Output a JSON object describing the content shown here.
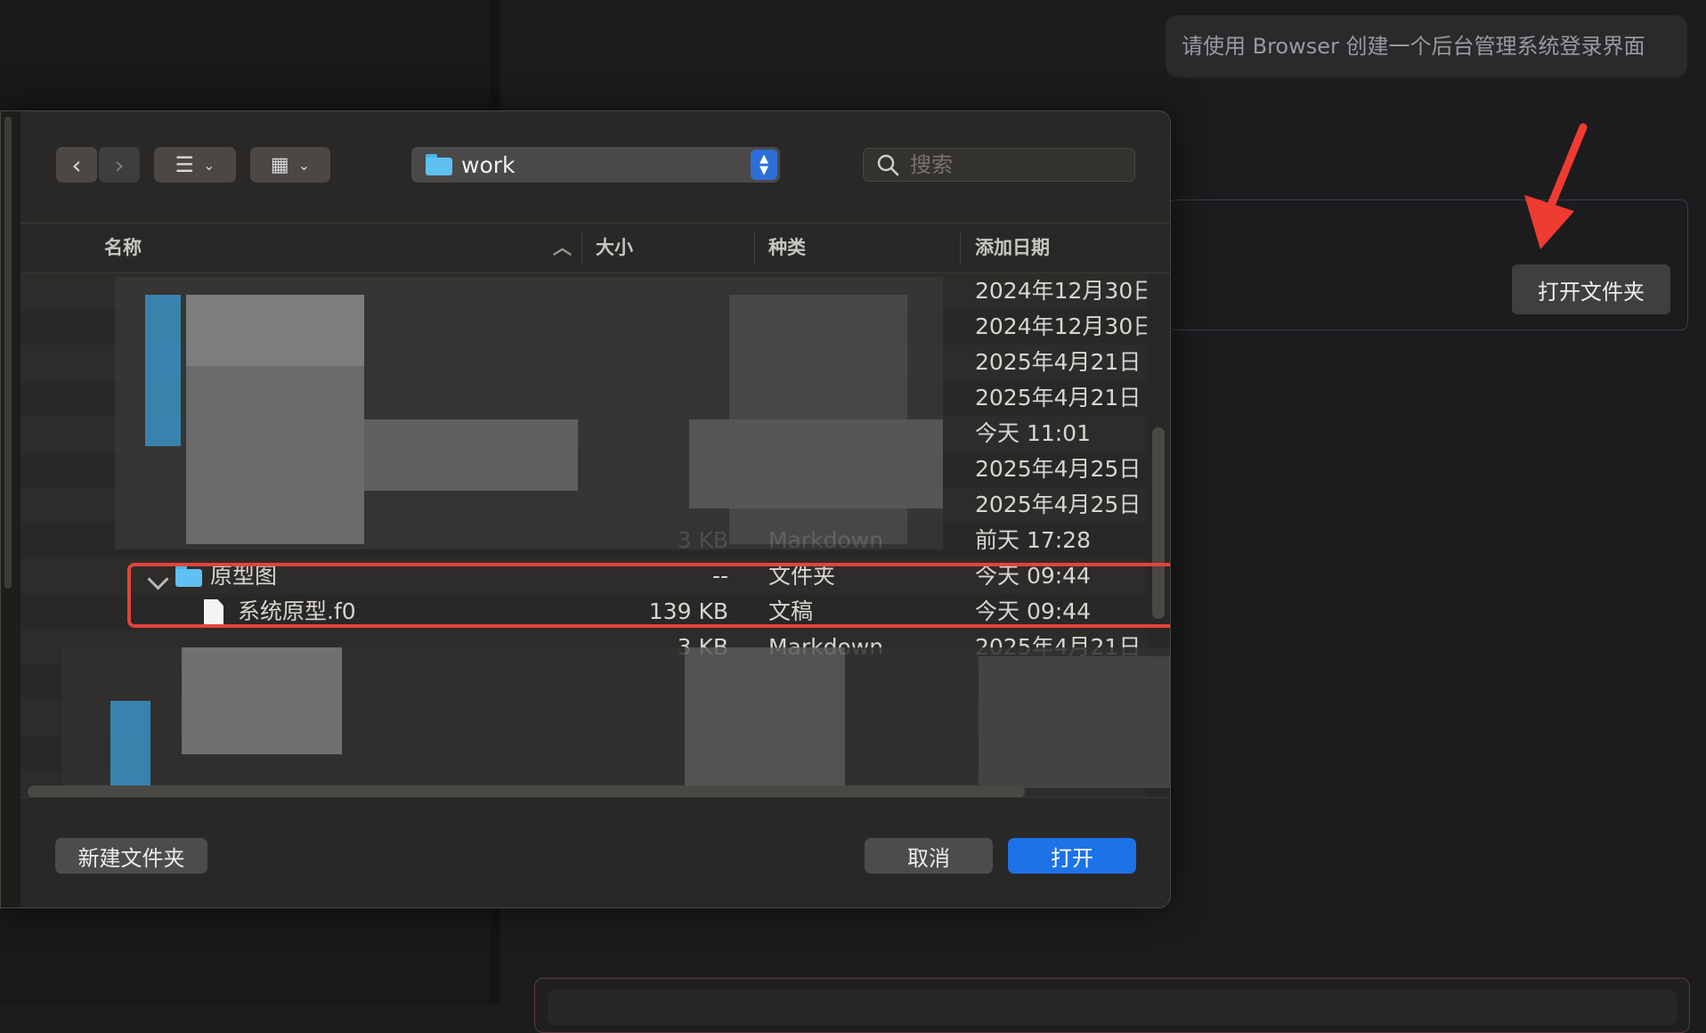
{
  "chat": {
    "message": "请使用 Browser 创建一个后台管理系统登录界面"
  },
  "card": {
    "open_folder_label": "打开文件夹"
  },
  "dialog": {
    "toolbar": {
      "back_icon": "chevron-left-icon",
      "forward_icon": "chevron-right-icon",
      "view_list_icon": "list-view-icon",
      "view_grid_icon": "grid-view-icon",
      "current_folder": "work",
      "search_placeholder": "搜索"
    },
    "columns": {
      "name": "名称",
      "size": "大小",
      "kind": "种类",
      "date_added": "添加日期"
    },
    "rows": [
      {
        "date": "2024年12月30日"
      },
      {
        "date": "2024年12月30日"
      },
      {
        "date": "2025年4月21日"
      },
      {
        "date": "2025年4月21日"
      },
      {
        "date": "今天 11:01"
      },
      {
        "date": "2025年4月25日"
      },
      {
        "date": "2025年4月25日"
      },
      {
        "size": "3 KB",
        "kind": "Markdown",
        "date": "前天 17:28"
      },
      {
        "name": "原型图",
        "size": "--",
        "kind": "文件夹",
        "date": "今天 09:44",
        "expanded": true,
        "icon": "folder-icon"
      },
      {
        "name": "系统原型.f0",
        "size": "139 KB",
        "kind": "文稿",
        "date": "今天 09:44",
        "icon": "document-icon"
      },
      {
        "size": "3 KB",
        "kind": "Markdown",
        "date": "2025年4月21日"
      }
    ],
    "footer": {
      "new_folder": "新建文件夹",
      "cancel": "取消",
      "open": "打开"
    }
  },
  "colors": {
    "accent": "#1d72e8",
    "highlight": "#e5433b",
    "arrow": "#f03b32"
  }
}
